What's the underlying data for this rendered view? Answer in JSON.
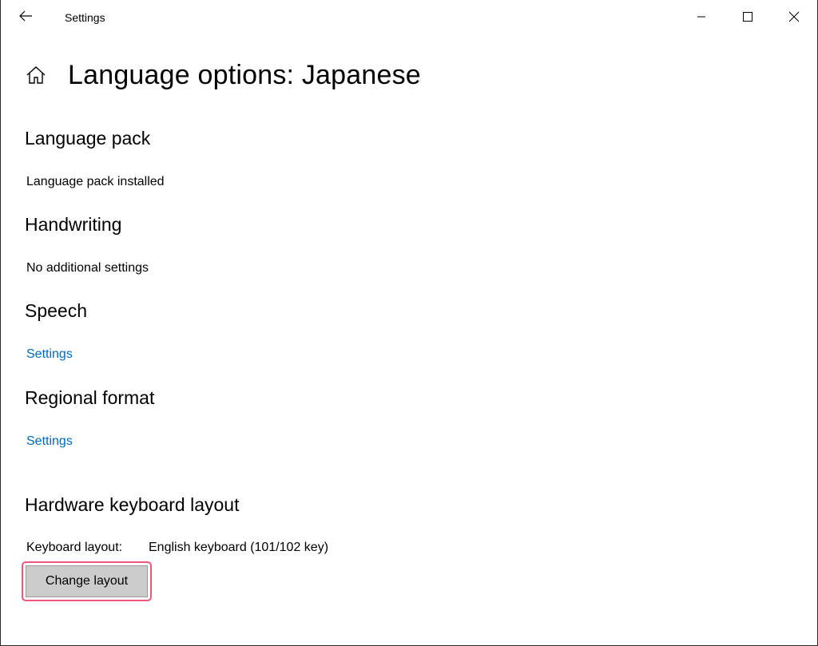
{
  "titlebar": {
    "title": "Settings",
    "back_icon": "arrow-left-icon",
    "minimize_icon": "minimize-icon",
    "maximize_icon": "maximize-icon",
    "close_icon": "close-icon"
  },
  "header": {
    "home_icon": "home-icon",
    "title": "Language options: Japanese"
  },
  "sections": {
    "language_pack": {
      "title": "Language pack",
      "status": "Language pack installed"
    },
    "handwriting": {
      "title": "Handwriting",
      "status": "No additional settings"
    },
    "speech": {
      "title": "Speech",
      "link": "Settings"
    },
    "regional_format": {
      "title": "Regional format",
      "link": "Settings"
    },
    "hardware_keyboard": {
      "title": "Hardware keyboard layout",
      "layout_label": "Keyboard layout:",
      "layout_value": "English keyboard (101/102 key)",
      "button_label": "Change layout"
    }
  },
  "colors": {
    "link": "#0067c0",
    "highlight": "#f0587a",
    "button_bg": "#cccccc"
  }
}
